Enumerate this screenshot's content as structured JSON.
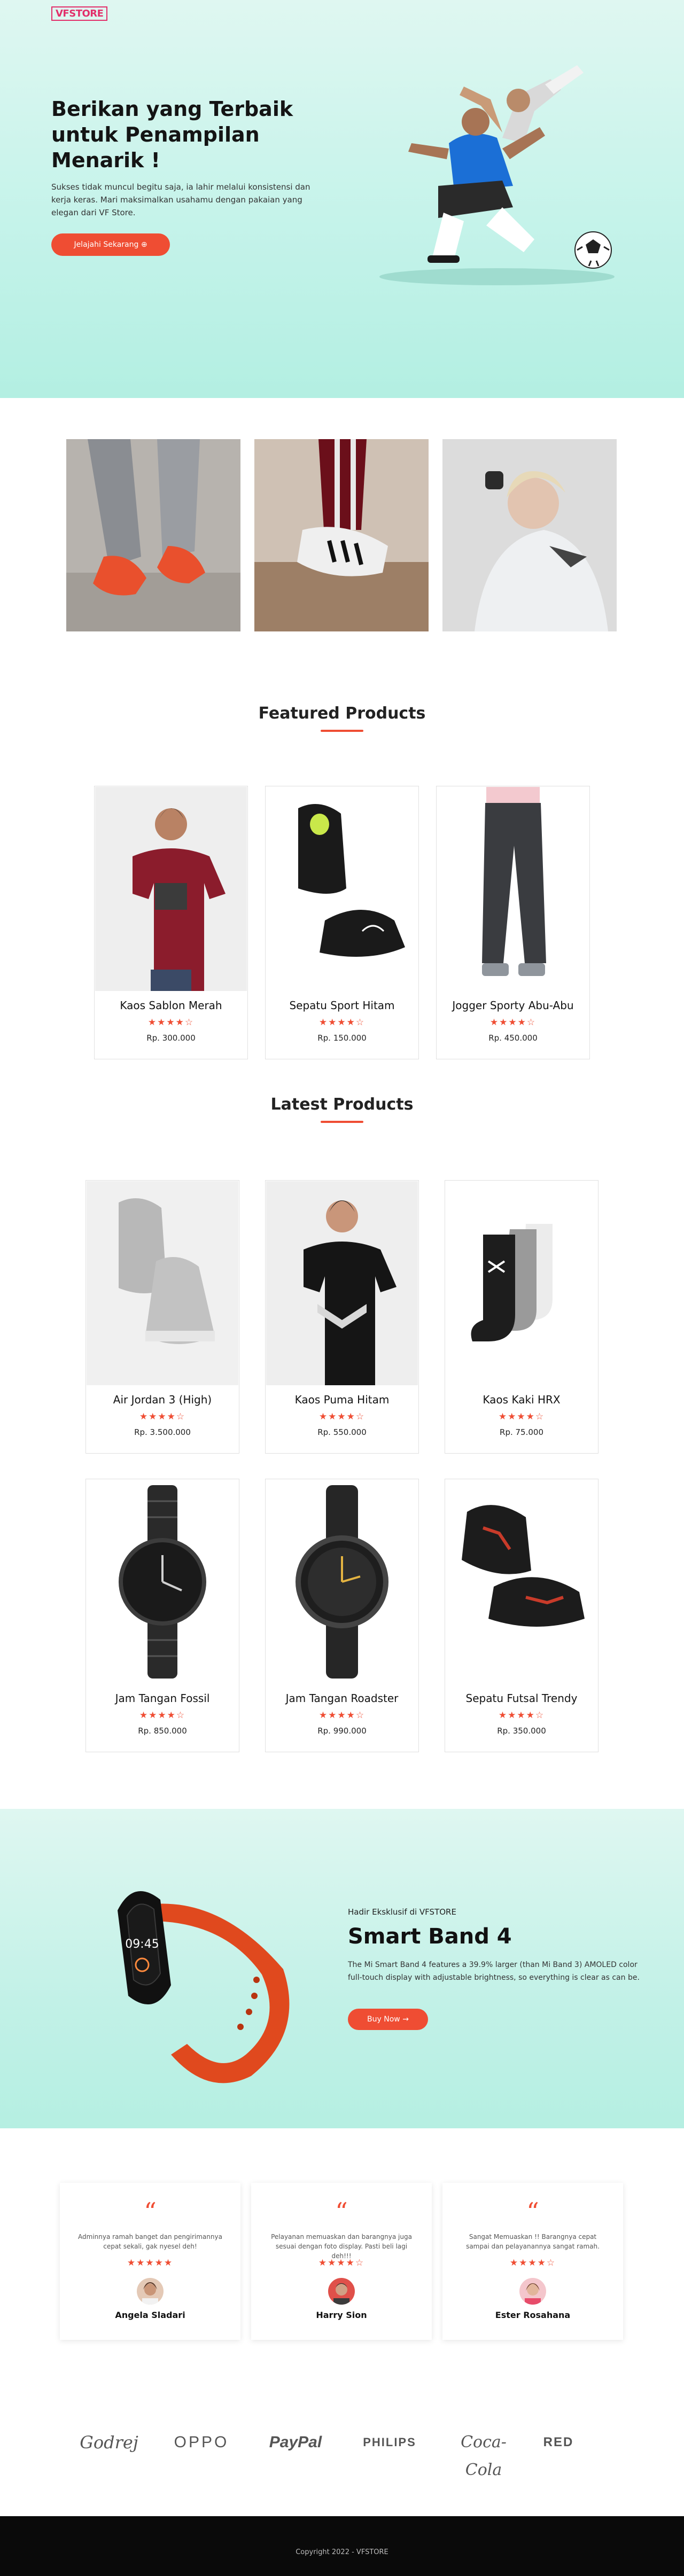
{
  "header": {
    "logo_text": "VFSTORE"
  },
  "hero": {
    "title": "Berikan yang Terbaik untuk Penampilan Menarik !",
    "text": "Sukses tidak muncul begitu saja, ia lahir melalui konsistensi dan kerja keras. Mari maksimalkan usahamu dengan pakaian yang elegan dari VF Store.",
    "button_label": "Jelajahi Sekarang ⊕"
  },
  "featured": {
    "title": "Featured Products",
    "products": [
      {
        "name": "Kaos Sablon Merah",
        "rating": "★★★★☆",
        "price": "Rp. 300.000"
      },
      {
        "name": "Sepatu Sport Hitam",
        "rating": "★★★★☆",
        "price": "Rp. 150.000"
      },
      {
        "name": "Jogger Sporty Abu-Abu",
        "rating": "★★★★☆",
        "price": "Rp. 450.000"
      }
    ]
  },
  "latest": {
    "title": "Latest Products",
    "products": [
      {
        "name": "Air Jordan 3 (High)",
        "rating": "★★★★☆",
        "price": "Rp. 3.500.000"
      },
      {
        "name": "Kaos Puma Hitam",
        "rating": "★★★★☆",
        "price": "Rp. 550.000"
      },
      {
        "name": "Kaos Kaki HRX",
        "rating": "★★★★☆",
        "price": "Rp. 75.000"
      },
      {
        "name": "Jam Tangan Fossil",
        "rating": "★★★★☆",
        "price": "Rp. 850.000"
      },
      {
        "name": "Jam Tangan Roadster",
        "rating": "★★★★☆",
        "price": "Rp. 990.000"
      },
      {
        "name": "Sepatu Futsal Trendy",
        "rating": "★★★★☆",
        "price": "Rp. 350.000"
      }
    ]
  },
  "promo": {
    "subtitle": "Hadir Eksklusif di VFSTORE",
    "title": "Smart Band 4",
    "text": "The Mi Smart Band 4 features a 39.9% larger (than Mi Band 3) AMOLED color full-touch display with adjustable brightness, so everything is clear as can be.",
    "button_label": "Buy Now →"
  },
  "testimonials": [
    {
      "quote": "“",
      "text": "Adminnya ramah banget dan pengirimannya cepat sekali, gak nyesel deh!",
      "rating": "★★★★★",
      "name": "Angela Sladari"
    },
    {
      "quote": "“",
      "text": "Pelayanan memuaskan dan barangnya juga sesuai dengan foto display. Pasti beli lagi deh!!!",
      "rating": "★★★★☆",
      "name": "Harry Sion"
    },
    {
      "quote": "“",
      "text": "Sangat Memuaskan !! Barangnya cepat sampai dan pelayanannya sangat ramah.",
      "rating": "★★★★☆",
      "name": "Ester Rosahana"
    }
  ],
  "brands": [
    "Godrej",
    "OPPO",
    "PayPal",
    "PHILIPS",
    "Coca-Cola",
    "RED"
  ],
  "footer": {
    "copyright": "Copyright 2022 - VFSTORE"
  },
  "colors": {
    "accent": "#ef4d33",
    "hero_bg": "#c5f3ea",
    "footer_bg": "#0a0a0a"
  }
}
